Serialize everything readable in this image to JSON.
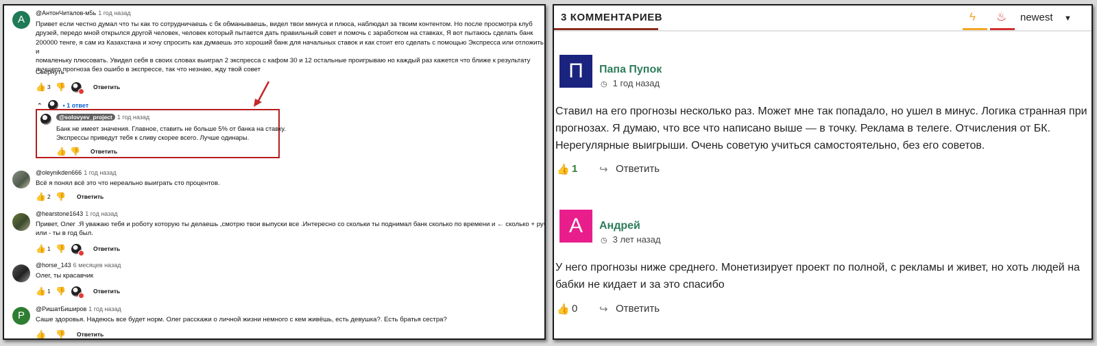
{
  "left": {
    "comments": [
      {
        "avatar_letter": "A",
        "avatar_color": "#1e7a57",
        "author": "@АнтонЧиталов-м5ь",
        "ago": "1 год назад",
        "lines": [
          "Привет если честно думал что ты как то сотрудничаешь с бк обманываешь, видел твои минуса и плюса, наблюдал за твоим контентом. Но после просмотра клуб",
          "друзей, передо мной открылся другой человек, человек который пытается дать правильный совет и помочь с заработком на ставках, Я вот пытаюсь сделать банк",
          "200000 тенге, я сам из Казахстана и хочу спросить как думаешь это хороший банк для начальных ставок и как стоит его сделать с помощью Экспресса или отложить и",
          "помаленьку плюсовать. Увидел себя в своих словах выиграл 2 экспресса с кафом 30 и 12 остальные проигрываю но каждый раз кажется что ближе к результату",
          "лучшего прогноза без ошибо в экспрессе, так что незнаю, жду твой совет"
        ],
        "collapse": "Свернуть",
        "likes": "3",
        "reply": "Ответить",
        "replies_toggle": "1 ответ"
      },
      {
        "author": "@oleynikden666",
        "ago": "1 год назад",
        "lines": [
          "Всё я понял всё это что нереально выиграть сто процентов."
        ],
        "likes": "2",
        "reply": "Ответить"
      },
      {
        "author": "@hearstone1643",
        "ago": "1 год назад",
        "lines": [
          "Привет, Олег .Я уважаю тебя и роботу которую ты делаешь ,смотрю твои выпуски все .Интересно со скольки ты поднимал банк сколько по времени и ← сколько + руб",
          "или - ты в год был."
        ],
        "likes": "1",
        "reply": "Ответить"
      },
      {
        "author": "@horse_143",
        "ago": "6 месяцев назад",
        "lines": [
          "Олег, ты красавчик"
        ],
        "likes": "1",
        "reply": "Ответить"
      },
      {
        "avatar_letter": "P",
        "avatar_color": "#2e7d32",
        "author": "@РишатБиширов",
        "ago": "1 год назад",
        "lines": [
          "Саше здоровья. Надеюсь все будет норм. Олег расскажи о личной жизни немного с кем живёшь, есть девушка?. Есть братья сестра?"
        ],
        "reply": "Ответить"
      }
    ],
    "highlight_reply": {
      "author": "@solovyev_project",
      "ago": "1 год назад",
      "lines": [
        "Банк не имеет значения. Главное, ставить не больше 5% от банка на ставку.",
        "Экспрессы приведут тебя к сливу скорее всего. Лучше одинары."
      ],
      "reply": "Ответить"
    },
    "highlight_color": "#b71c1c"
  },
  "right": {
    "count_label": "3 КОММЕНТАРИЕВ",
    "sort_label": "newest",
    "accent": "#8b2a1f",
    "comments": [
      {
        "avatar_letter": "П",
        "avatar_color": "#1a237e",
        "name": "Папа Пупок",
        "time": "1 год назад",
        "lines": [
          "Ставил на его прогнозы несколько раз. Может мне так попадало, но ушел в минус. Логика странная при",
          "прогнозах. Я думаю, что все что написано выше — в точку. Реклама в телеге. Отчисления от БК.",
          "Нерегулярные выигрыши. Очень советую учиться самостоятельно, без его советов."
        ],
        "likes": "1",
        "likes_color": "#2e7d32",
        "reply": "Ответить"
      },
      {
        "avatar_letter": "А",
        "avatar_color": "#e91e8c",
        "name": "Андрей",
        "time": "3 лет назад",
        "lines": [
          "У него прогнозы ниже среднего. Монетизирует проект по полной, с рекламы и живет, но хоть людей на",
          "бабки не кидает и за это спасибо"
        ],
        "likes": "0",
        "likes_color": "#333333",
        "reply": "Ответить"
      }
    ]
  }
}
